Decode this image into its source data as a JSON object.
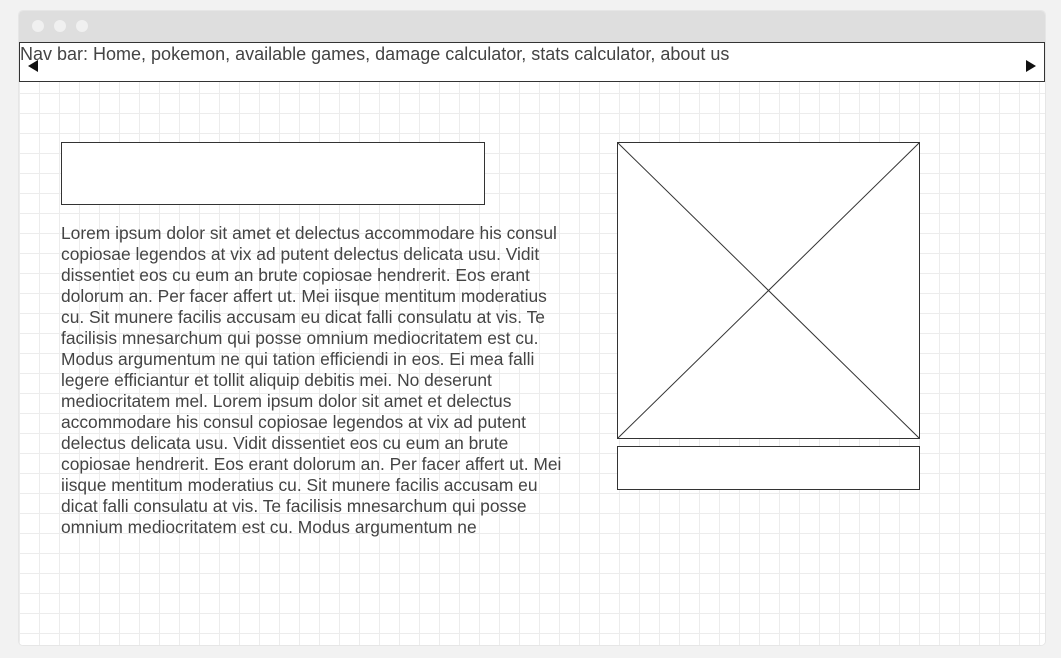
{
  "nav": {
    "text": "Nav bar: Home, pokemon, available games, damage calculator, stats calculator, about us",
    "left_arrow_icon": "triangle-left-icon",
    "right_arrow_icon": "triangle-right-icon"
  },
  "content": {
    "title_box_text": "",
    "paragraph": "Lorem ipsum dolor sit amet et delectus accommodare his consul copiosae legendos at vix ad putent delectus delicata usu. Vidit dissentiet eos cu eum an brute copiosae hendrerit. Eos erant dolorum an. Per facer affert ut. Mei iisque mentitum moderatius cu. Sit munere facilis accusam eu dicat falli consulatu at vis. Te facilisis mnesarchum qui posse omnium mediocritatem est cu. Modus argumentum ne qui tation efficiendi in eos. Ei mea falli legere efficiantur et tollit aliquip debitis mei. No deserunt mediocritatem mel. Lorem ipsum dolor sit amet et delectus accommodare his consul copiosae legendos at vix ad putent delectus delicata usu. Vidit dissentiet eos cu eum an brute copiosae hendrerit. Eos erant dolorum an. Per facer affert ut. Mei iisque mentitum moderatius cu. Sit munere facilis accusam eu dicat falli consulatu at vis. Te facilisis mnesarchum qui posse omnium mediocritatem est cu. Modus argumentum ne",
    "image_icon": "image-placeholder-icon",
    "caption_text": ""
  }
}
